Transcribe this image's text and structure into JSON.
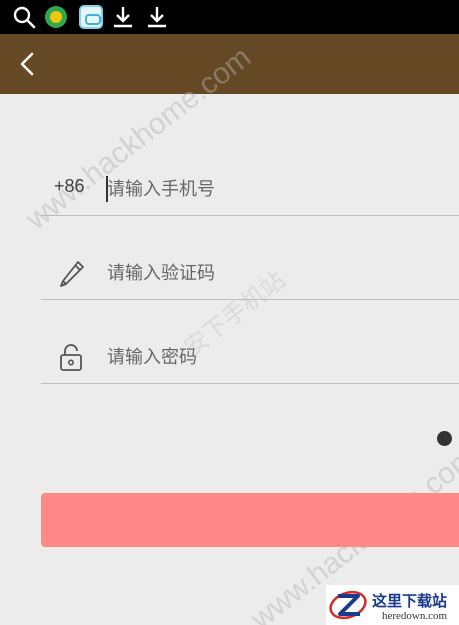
{
  "status_bar": {
    "icons": [
      "search-icon",
      "clover-app-icon",
      "app-icon",
      "download-icon",
      "download-icon"
    ]
  },
  "app_bar": {
    "back_icon": "chevron-left-icon",
    "background": "#654925"
  },
  "form": {
    "phone": {
      "country_code": "+86",
      "placeholder": "请输入手机号",
      "value": ""
    },
    "code": {
      "icon": "pencil-icon",
      "placeholder": "请输入验证码",
      "value": ""
    },
    "password": {
      "icon": "unlock-icon",
      "placeholder": "请输入密码",
      "value": ""
    },
    "submit": {
      "label": "",
      "color": "#ff8888"
    }
  },
  "watermarks": {
    "top": "www.hackhome.com",
    "middle": "安下手机站",
    "bottom": "www.hackhome.com"
  },
  "logo": {
    "cn": "这里下载站",
    "en": "heredown.com"
  }
}
